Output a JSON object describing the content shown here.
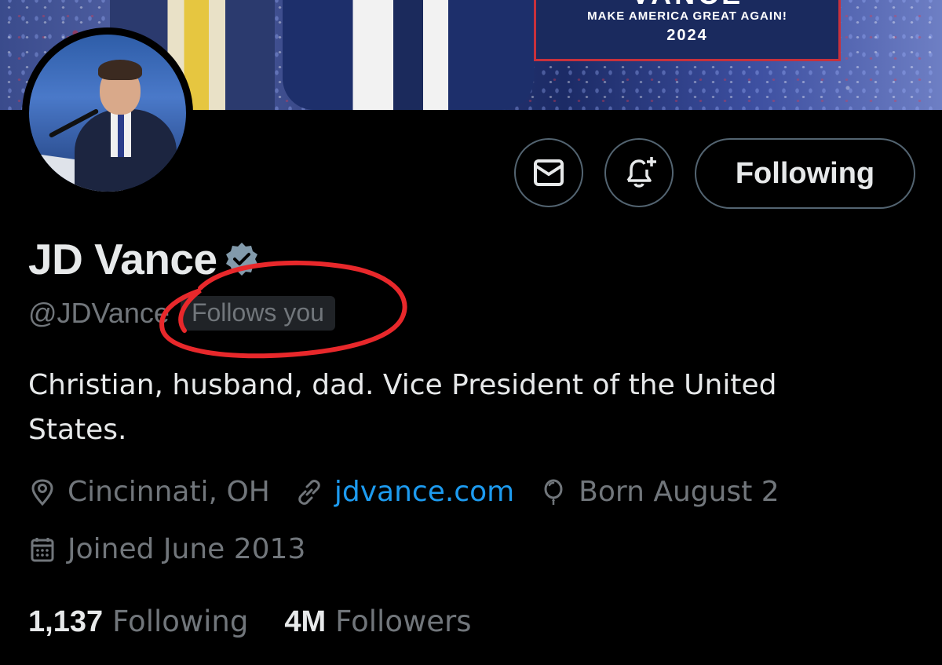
{
  "banner": {
    "sign_top": "VANCE",
    "slogan": "MAKE AMERICA GREAT AGAIN!",
    "year": "2024"
  },
  "profile": {
    "display_name": "JD Vance",
    "handle": "@JDVance",
    "follows_you": "Follows you",
    "bio": "Christian, husband, dad. Vice President of the United States.",
    "location": "Cincinnati, OH",
    "website": "jdvance.com",
    "birthday": "Born August 2",
    "joined": "Joined June 2013"
  },
  "actions": {
    "following_label": "Following",
    "message_icon": "envelope-icon",
    "notify_icon": "bell-plus-icon"
  },
  "stats": {
    "following_count": "1,137",
    "following_label": "Following",
    "followers_count": "4M",
    "followers_label": "Followers"
  },
  "colors": {
    "background": "#000000",
    "text_primary": "#e7e9ea",
    "text_secondary": "#71767b",
    "link": "#1d9bf0",
    "border": "#536471",
    "annotation": "#e8282b"
  }
}
